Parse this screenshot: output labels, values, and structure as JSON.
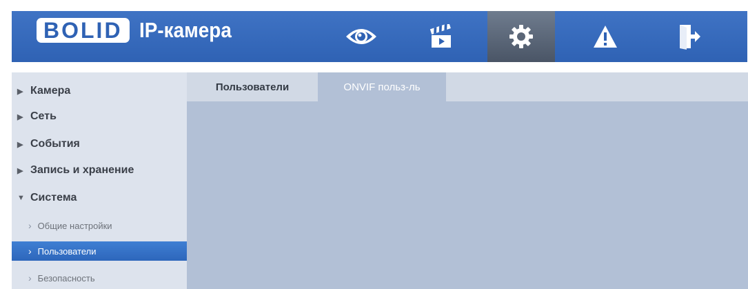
{
  "header": {
    "logo_brand": "BOLID",
    "logo_text": "IP-камера",
    "nav": [
      {
        "icon": "eye-icon",
        "active": false
      },
      {
        "icon": "clapperboard-icon",
        "active": false
      },
      {
        "icon": "gear-icon",
        "active": true
      },
      {
        "icon": "warning-icon",
        "active": false
      },
      {
        "icon": "exit-icon",
        "active": false
      }
    ]
  },
  "sidebar": {
    "items": [
      {
        "label": "Камера",
        "expanded": false
      },
      {
        "label": "Сеть",
        "expanded": false
      },
      {
        "label": "События",
        "expanded": false
      },
      {
        "label": "Запись и хранение",
        "expanded": false
      },
      {
        "label": "Система",
        "expanded": true
      }
    ],
    "subitems": [
      {
        "label": "Общие настройки",
        "selected": false
      },
      {
        "label": "Пользователи",
        "selected": true
      },
      {
        "label": "Безопасность",
        "selected": false
      }
    ]
  },
  "tabs": [
    {
      "label": "Пользователи",
      "active": true
    },
    {
      "label": "ONVIF польз-ль",
      "active": false
    }
  ],
  "colors": {
    "header_blue": "#2f62b4",
    "selected_blue": "#3f7fd3",
    "content_bg": "#b2c0d6"
  }
}
